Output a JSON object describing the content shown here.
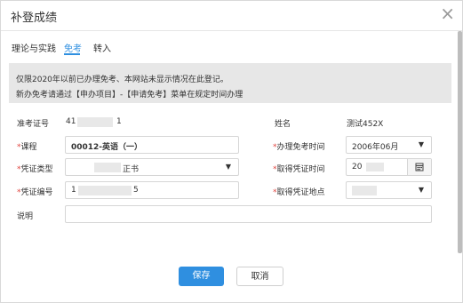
{
  "dialog": {
    "title": "补登成绩",
    "close_symbol": "×"
  },
  "tabs": [
    {
      "label": "理论与实践",
      "active": false
    },
    {
      "label": "免考",
      "active": true
    },
    {
      "label": "转入",
      "active": false
    }
  ],
  "notice": {
    "line1": "仅限2020年以前已办理免考、本网站未显示情况在此登记。",
    "line2": "新办免考请通过【申办项目】-【申请免考】菜单在规定时间办理"
  },
  "form": {
    "exam_no": {
      "label": "准考证号",
      "value_prefix": "41",
      "value_suffix": "1"
    },
    "name": {
      "label": "姓名",
      "value": "测试452X"
    },
    "course": {
      "label": "课程",
      "value": "00012-英语（一）"
    },
    "exempt_time": {
      "label": "办理免考时间",
      "value": "2006年06月"
    },
    "cert_type": {
      "label": "凭证类型",
      "value": "正书"
    },
    "cert_obtain_time": {
      "label": "取得凭证时间",
      "value": "20"
    },
    "cert_no": {
      "label": "凭证编号",
      "value_prefix": "1",
      "value_suffix": "5"
    },
    "cert_place": {
      "label": "取得凭证地点",
      "value": ""
    },
    "remark": {
      "label": "说明",
      "value": ""
    }
  },
  "buttons": {
    "save": "保存",
    "cancel": "取消"
  },
  "colors": {
    "primary": "#2f8fe0",
    "required": "#e0443e",
    "notice_bg": "#e7e7e7"
  }
}
